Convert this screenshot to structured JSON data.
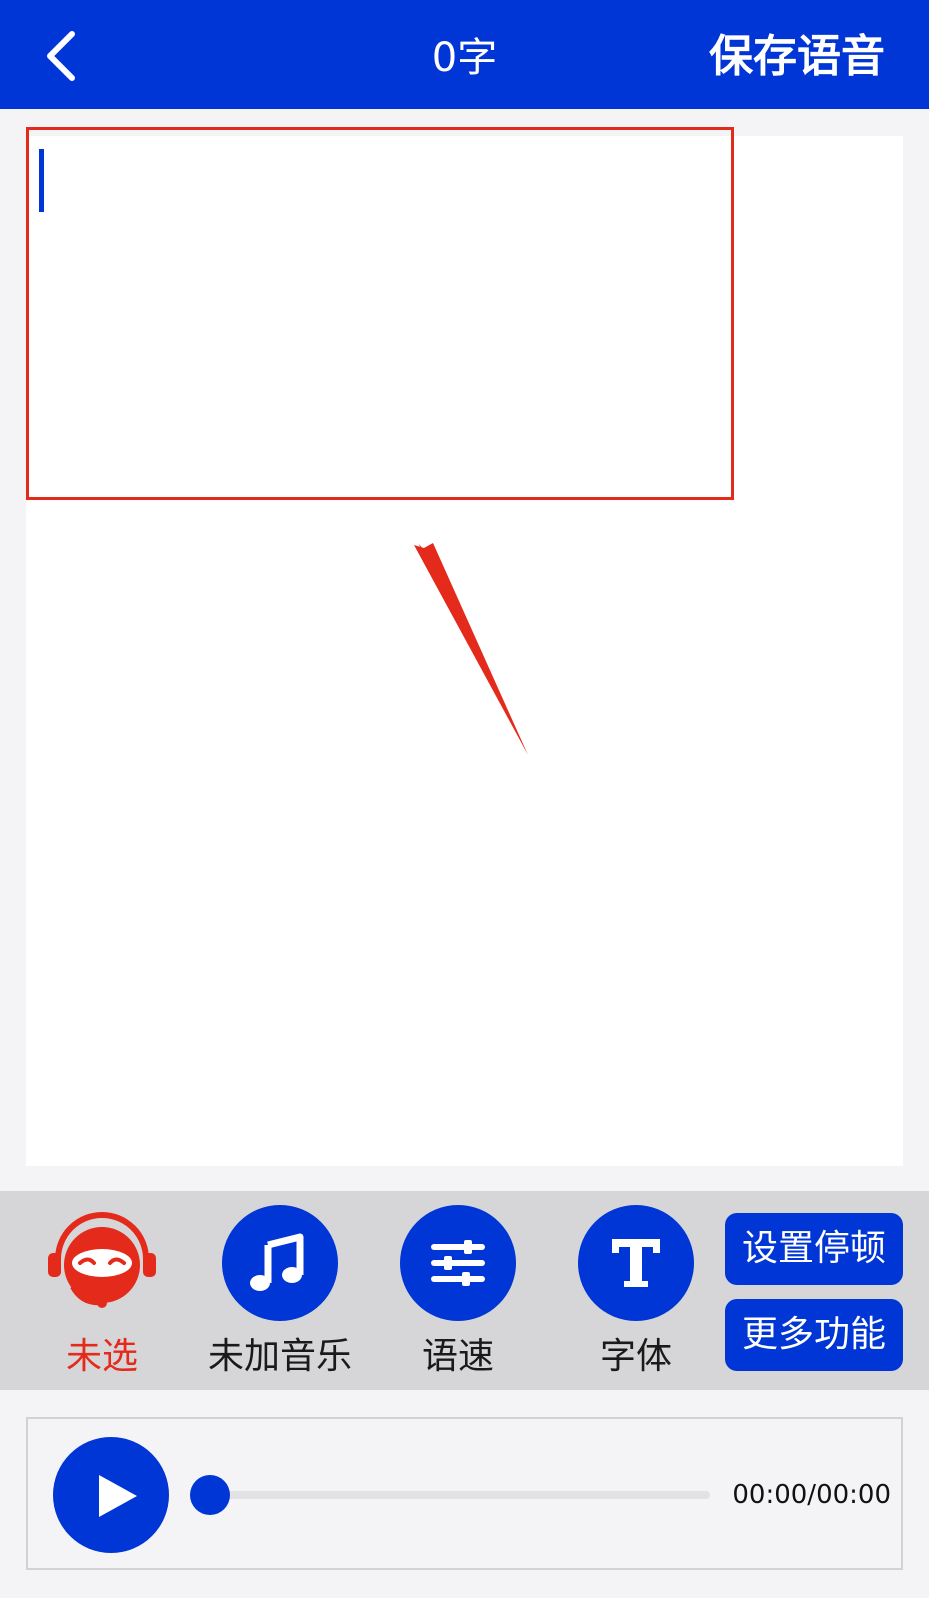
{
  "header": {
    "back_icon": "chevron-left-icon",
    "word_count": "0字",
    "save_label": "保存语音"
  },
  "editor": {
    "text": "",
    "focused": true
  },
  "annotation": {
    "highlight_color": "#e42a1b"
  },
  "toolbar": {
    "tools": [
      {
        "icon": "voice-avatar-icon",
        "label": "未选",
        "color": "#e42a1b"
      },
      {
        "icon": "music-note-icon",
        "label": "未加音乐",
        "color": "#1a1a1a"
      },
      {
        "icon": "sliders-icon",
        "label": "语速",
        "color": "#1a1a1a"
      },
      {
        "icon": "font-t-icon",
        "label": "字体",
        "color": "#1a1a1a"
      }
    ],
    "set_pause_label": "设置停顿",
    "more_label": "更多功能"
  },
  "player": {
    "play_icon": "play-icon",
    "progress": 0,
    "time": "00:00/00:00"
  },
  "colors": {
    "accent": "#0035d6",
    "alert": "#e42a1b",
    "toolbar_bg": "#d6d6d8",
    "page_bg": "#f4f4f6"
  }
}
